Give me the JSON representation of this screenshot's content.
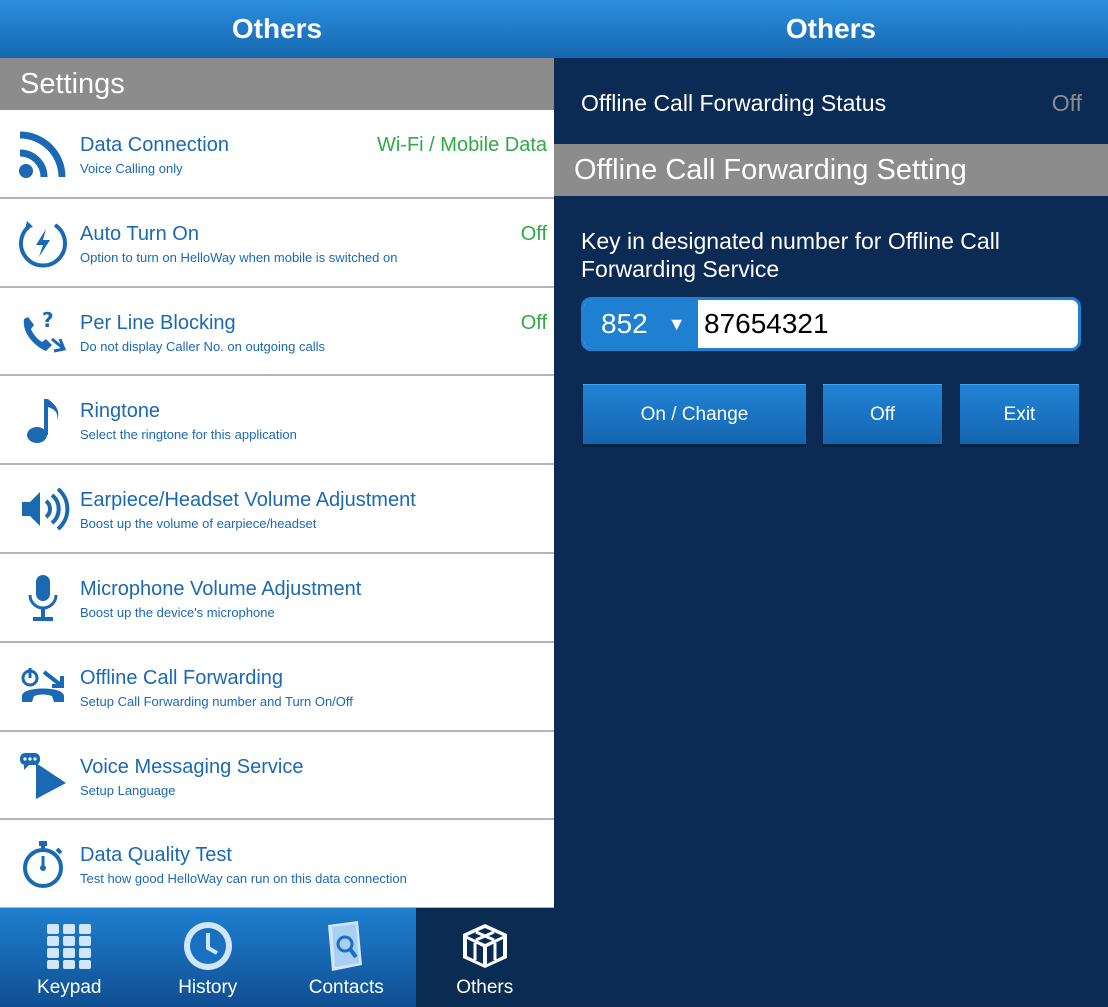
{
  "left": {
    "title": "Others",
    "section": "Settings",
    "items": [
      {
        "icon": "wifi-signal-icon",
        "title": "Data Connection",
        "subtitle": "Voice Calling only",
        "value": "Wi-Fi / Mobile Data"
      },
      {
        "icon": "auto-power-icon",
        "title": "Auto Turn On",
        "subtitle": "Option to turn on HelloWay when mobile is switched on",
        "value": "Off"
      },
      {
        "icon": "phone-block-icon",
        "title": "Per Line Blocking",
        "subtitle": "Do not display Caller No. on outgoing calls",
        "value": "Off"
      },
      {
        "icon": "music-note-icon",
        "title": "Ringtone",
        "subtitle": "Select the ringtone for this application",
        "value": ""
      },
      {
        "icon": "speaker-icon",
        "title": "Earpiece/Headset Volume Adjustment",
        "subtitle": "Boost up the volume of earpiece/headset",
        "value": ""
      },
      {
        "icon": "microphone-icon",
        "title": "Microphone Volume Adjustment",
        "subtitle": "Boost up the device's microphone",
        "value": ""
      },
      {
        "icon": "call-forward-icon",
        "title": "Offline Call Forwarding",
        "subtitle": "Setup Call Forwarding number and Turn On/Off",
        "value": ""
      },
      {
        "icon": "voice-message-icon",
        "title": "Voice Messaging Service",
        "subtitle": "Setup Language",
        "value": ""
      },
      {
        "icon": "stopwatch-icon",
        "title": "Data Quality Test",
        "subtitle": "Test how good HelloWay can run on this data connection",
        "value": ""
      }
    ],
    "nav": [
      {
        "icon": "keypad-icon",
        "label": "Keypad"
      },
      {
        "icon": "clock-icon",
        "label": "History"
      },
      {
        "icon": "contacts-book-icon",
        "label": "Contacts"
      },
      {
        "icon": "cube-icon",
        "label": "Others",
        "active": true
      }
    ]
  },
  "right": {
    "title": "Others",
    "status_label": "Offline Call Forwarding Status",
    "status_value": "Off",
    "section": "Offline Call Forwarding Setting",
    "instructions": "Key in designated number for Offline Call Forwarding Service",
    "country_code": "852",
    "phone_number": "87654321",
    "buttons": {
      "on_change": "On / Change",
      "off": "Off",
      "exit": "Exit"
    }
  },
  "colors": {
    "accent_blue": "#1b68b3",
    "value_green": "#2eaa47",
    "dark_bg": "#0b2b55",
    "section_gray": "#8c8c8c"
  }
}
